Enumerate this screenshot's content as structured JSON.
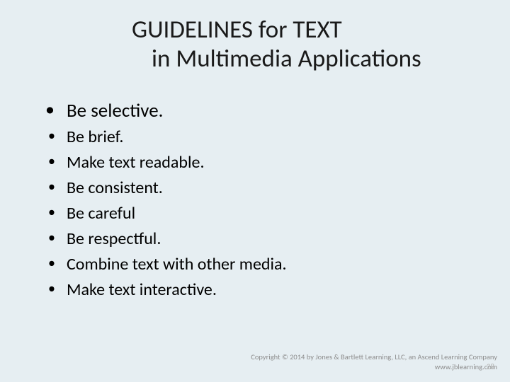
{
  "title": {
    "line1": "GUIDELINES for TEXT",
    "line2": "in Multimedia Applications"
  },
  "bullets": {
    "b0": "Be selective.",
    "b1": "Be brief.",
    "b2": "Make text readable.",
    "b3": "Be consistent.",
    "b4": "Be careful",
    "b5": "Be respectful.",
    "b6": "Combine text with other media.",
    "b7": "Make text interactive."
  },
  "footer": {
    "copyright": "Copyright © 2014 by Jones & Bartlett Learning, LLC, an Ascend Learning Company",
    "url": "www.jblearning.com"
  },
  "slide_number": "28"
}
